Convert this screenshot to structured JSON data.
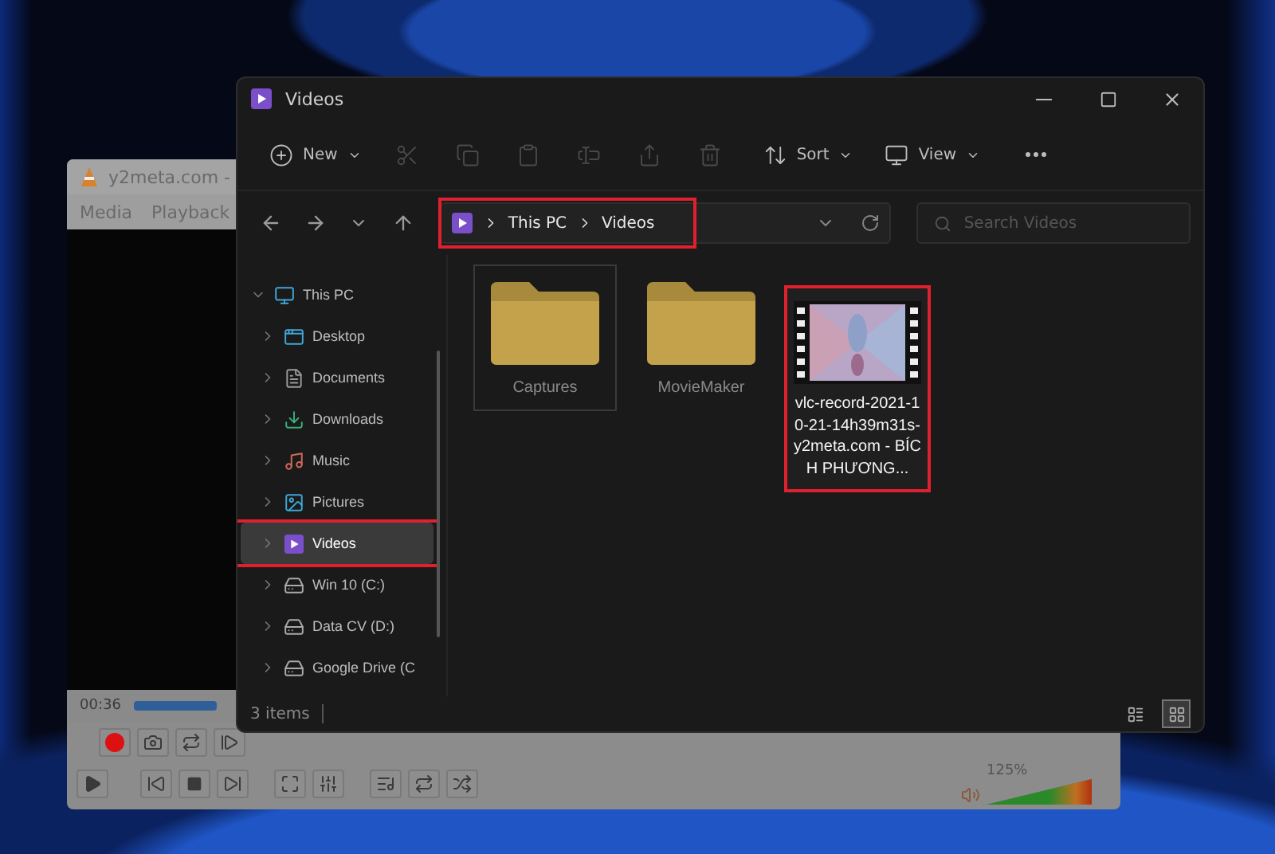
{
  "vlc": {
    "title": "y2meta.com -",
    "menu": [
      "Media",
      "Playback"
    ],
    "time": "00:36",
    "progress": {
      "level": 1
    },
    "volume": {
      "reading": "125%",
      "level": 1
    }
  },
  "explorer": {
    "title": "Videos",
    "toolbar": [
      {
        "kind": "new",
        "label": "New",
        "disabled": false
      },
      {
        "kind": "cut",
        "disabled": true
      },
      {
        "kind": "copy",
        "disabled": true
      },
      {
        "kind": "paste",
        "disabled": true
      },
      {
        "kind": "rename",
        "disabled": true
      },
      {
        "kind": "share",
        "disabled": true
      },
      {
        "kind": "delete",
        "disabled": true
      },
      {
        "kind": "sort",
        "label": "Sort",
        "disabled": false
      },
      {
        "kind": "view",
        "label": "View",
        "disabled": false
      },
      {
        "kind": "more",
        "disabled": false
      }
    ],
    "address": {
      "crumbs": [
        "This PC",
        "Videos"
      ],
      "highlighted": true
    },
    "search": {
      "placeholder": "Search Videos"
    },
    "nav": [
      {
        "label": "This PC",
        "kind": "pc",
        "expanded": true,
        "selected": false,
        "highlighted": false,
        "children": [
          {
            "label": "Desktop",
            "kind": "desktop",
            "expanded": false,
            "selected": false,
            "highlighted": false
          },
          {
            "label": "Documents",
            "kind": "documents",
            "expanded": false,
            "selected": false,
            "highlighted": false
          },
          {
            "label": "Downloads",
            "kind": "downloads",
            "expanded": false,
            "selected": false,
            "highlighted": false
          },
          {
            "label": "Music",
            "kind": "music",
            "expanded": false,
            "selected": false,
            "highlighted": false
          },
          {
            "label": "Pictures",
            "kind": "pictures",
            "expanded": false,
            "selected": false,
            "highlighted": false
          },
          {
            "label": "Videos",
            "kind": "videos",
            "expanded": false,
            "selected": true,
            "highlighted": true
          },
          {
            "label": "Win 10 (C:)",
            "kind": "drive",
            "expanded": false,
            "selected": false,
            "highlighted": false
          },
          {
            "label": "Data CV (D:)",
            "kind": "drive",
            "expanded": false,
            "selected": false,
            "highlighted": false
          },
          {
            "label": "Google Drive (C",
            "kind": "drive",
            "expanded": false,
            "selected": false,
            "highlighted": false
          }
        ]
      }
    ],
    "files": [
      {
        "name": "Captures",
        "kind": "folder",
        "focused": true,
        "highlighted": false
      },
      {
        "name": "MovieMaker",
        "kind": "folder",
        "focused": false,
        "highlighted": false
      },
      {
        "name": "vlc-record-2021-10-21-14h39m31s-y2meta.com - BÍCH PHƯƠNG...",
        "kind": "video",
        "focused": false,
        "highlighted": true
      }
    ],
    "status": "3 items",
    "views": [
      {
        "kind": "details",
        "selected": false
      },
      {
        "kind": "tiles",
        "selected": true
      }
    ]
  }
}
